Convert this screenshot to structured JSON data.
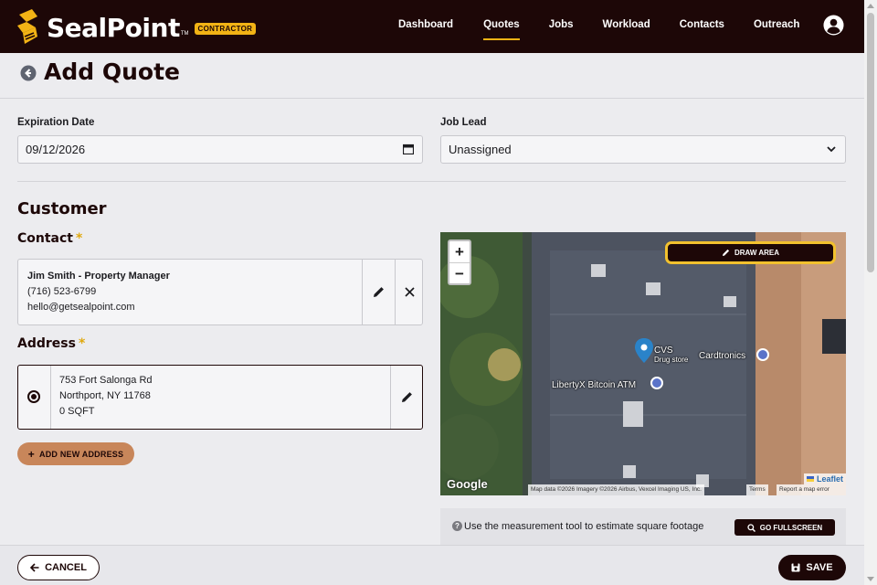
{
  "app": {
    "brand_name": "SealPoint",
    "brand_tm": "TM",
    "brand_badge": "CONTRACTOR",
    "accent_color": "#f2b315",
    "dark_color": "#1d0707"
  },
  "nav": {
    "items": [
      {
        "label": "Dashboard",
        "active": false
      },
      {
        "label": "Quotes",
        "active": true
      },
      {
        "label": "Jobs",
        "active": false
      },
      {
        "label": "Workload",
        "active": false
      },
      {
        "label": "Contacts",
        "active": false
      },
      {
        "label": "Outreach",
        "active": false
      }
    ],
    "avatar_icon": "user-circle-icon"
  },
  "header": {
    "title": "Add Quote",
    "back_icon": "arrow-left-circle-icon"
  },
  "form": {
    "expiration_label": "Expiration Date",
    "expiration_value": "09/12/2026",
    "job_lead_label": "Job Lead",
    "job_lead_value": "Unassigned"
  },
  "customer": {
    "section_title": "Customer",
    "contact_label": "Contact",
    "required_mark": "*",
    "contact": {
      "name": "Jim Smith - Property Manager",
      "phone": "(716) 523-6799",
      "email": "hello@getsealpoint.com"
    },
    "address_label": "Address",
    "address": {
      "line1": "753 Fort Salonga Rd",
      "line2": "Northport, NY 11768",
      "area": "0 SQFT"
    },
    "add_address_label": "ADD NEW ADDRESS"
  },
  "map": {
    "zoom_in": "+",
    "zoom_out": "−",
    "draw_area_label": "DRAW AREA",
    "labels": {
      "cvs": "CVS",
      "cvs_sub": "Drug store",
      "cardtronics": "Cardtronics",
      "bitcoin_atm": "LibertyX Bitcoin ATM"
    },
    "google_logo": "Google",
    "leaflet_label": "Leaflet",
    "attribution": "Map data ©2026 Imagery ©2026 Airbus, Vexcel Imaging US, Inc.",
    "terms": "Terms",
    "report": "Report a map error"
  },
  "info": {
    "icon": "?",
    "text": "Use the measurement tool to estimate square footage",
    "fullscreen_label": "GO FULLSCREEN"
  },
  "footer": {
    "cancel_label": "CANCEL",
    "save_label": "SAVE"
  }
}
